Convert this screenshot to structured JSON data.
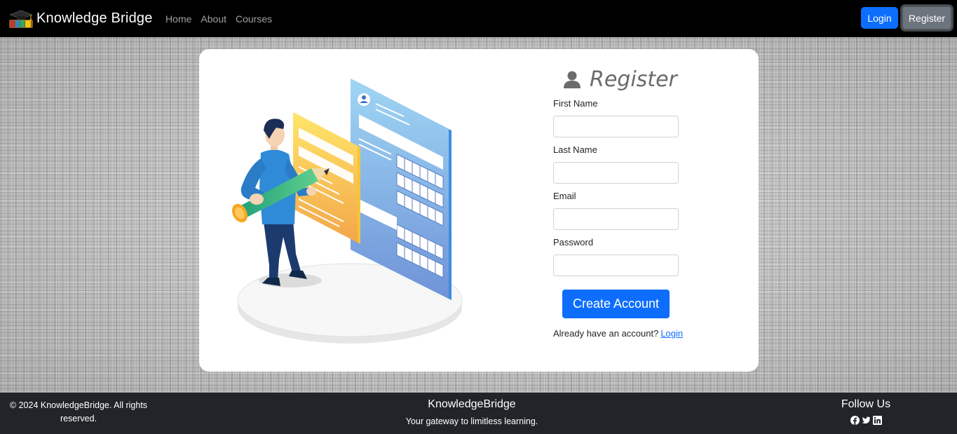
{
  "nav": {
    "brand_title": "Knowledge Bridge",
    "logo_icon": "graduation-cap-books-logo",
    "links": [
      {
        "label": "Home"
      },
      {
        "label": "About"
      },
      {
        "label": "Courses"
      }
    ],
    "login_label": "Login",
    "register_label": "Register"
  },
  "form": {
    "title": "Register",
    "title_icon": "user-icon",
    "fields": [
      {
        "label": "First Name",
        "value": "",
        "placeholder": ""
      },
      {
        "label": "Last Name",
        "value": "",
        "placeholder": ""
      },
      {
        "label": "Email",
        "value": "",
        "placeholder": ""
      },
      {
        "label": "Password",
        "value": "",
        "placeholder": ""
      }
    ],
    "submit_label": "Create Account",
    "login_prompt": "Already have an account?",
    "login_link": "Login"
  },
  "footer": {
    "copyright": "© 2024 KnowledgeBridge. All rights reserved.",
    "brand": "KnowledgeBridge",
    "tagline": "Your gateway to limitless learning.",
    "follow_title": "Follow Us",
    "social_icons": [
      "facebook-icon",
      "twitter-icon",
      "linkedin-icon"
    ]
  },
  "colors": {
    "navbar": "#000000",
    "primary": "#0d6efd",
    "secondary": "#6c757d",
    "footer": "#212529"
  }
}
